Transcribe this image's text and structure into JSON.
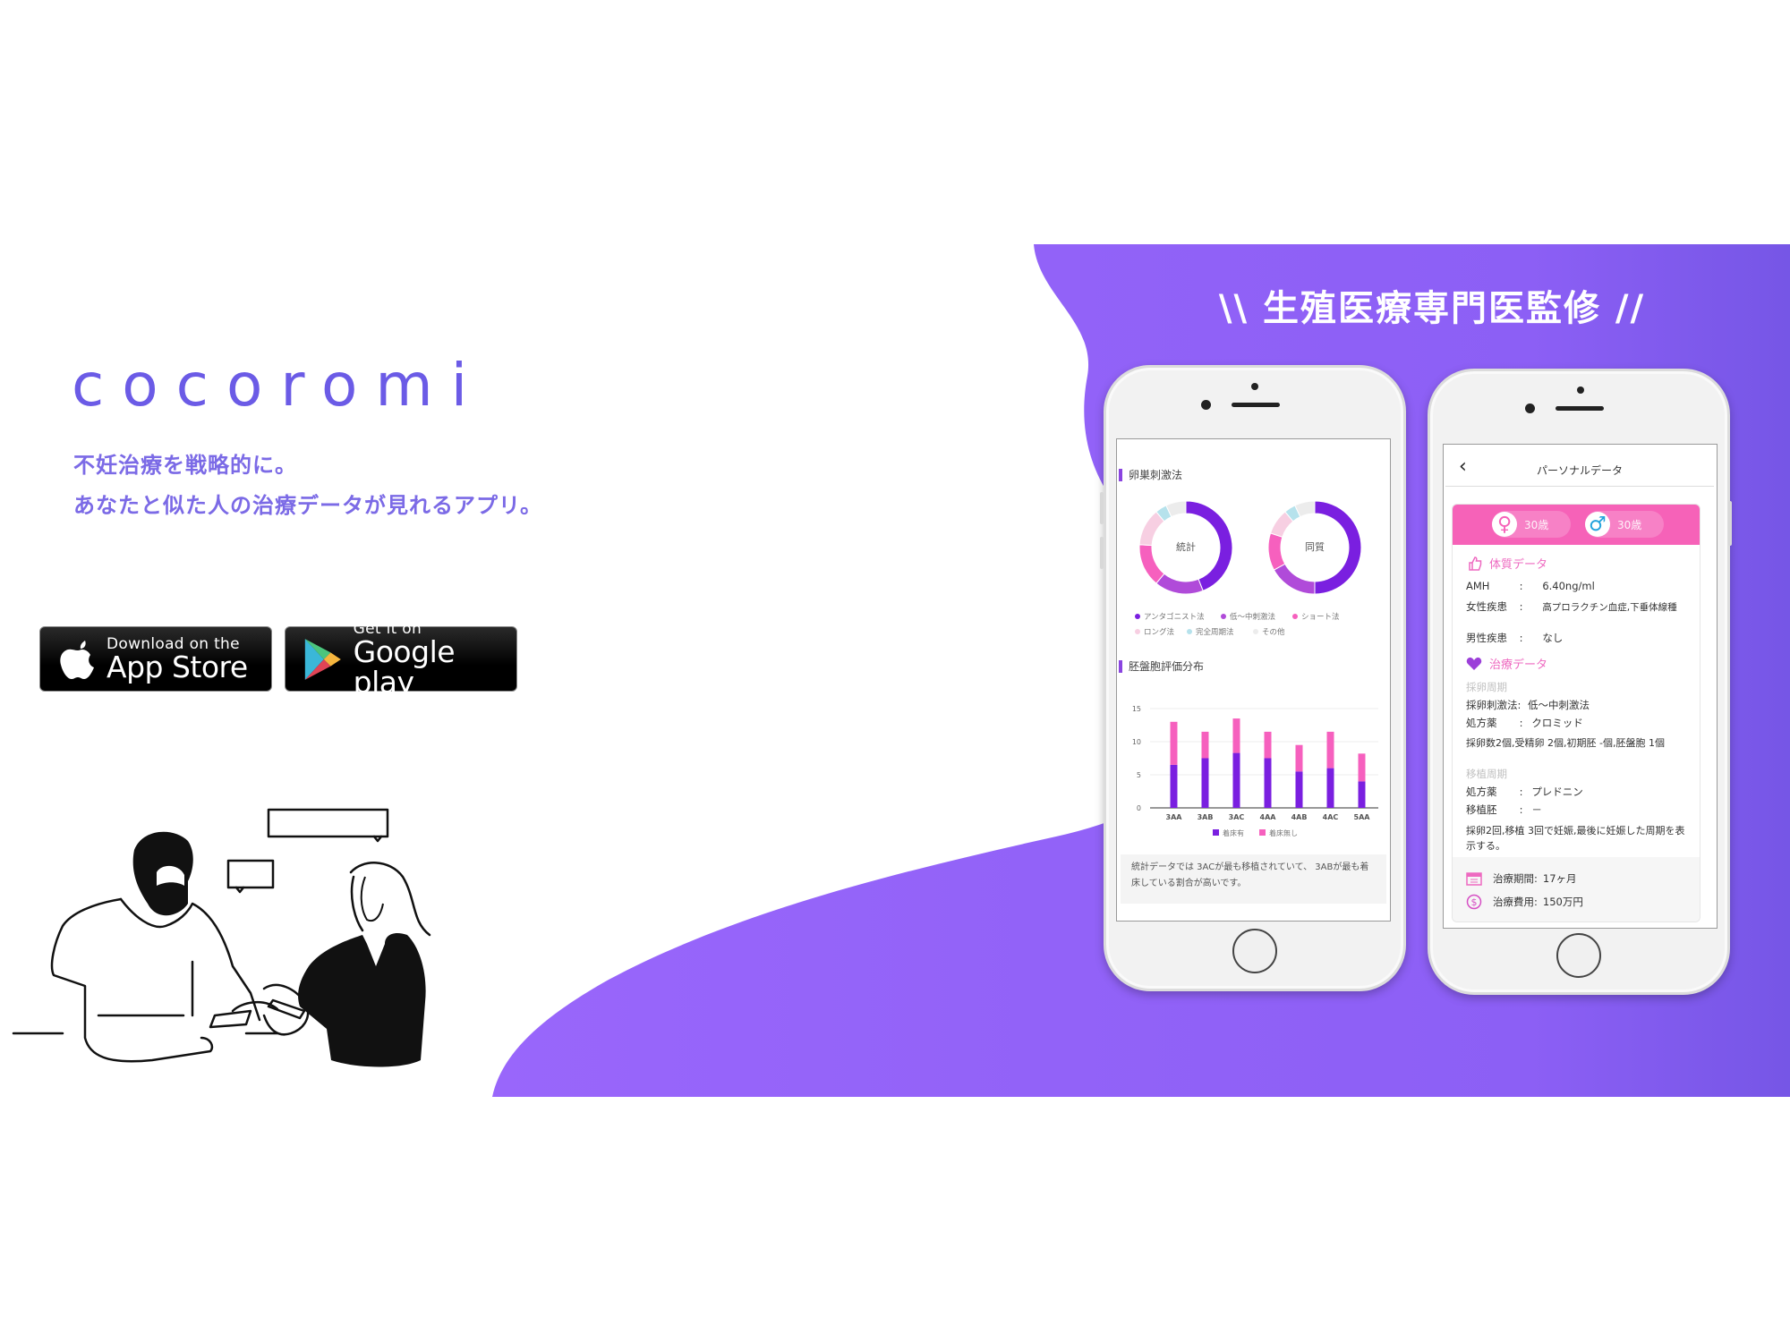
{
  "brand": {
    "logo": "cocoromi",
    "tagline_1": "不妊治療を戦略的に。",
    "tagline_2": "あなたと似た人の治療データが見れるアプリ。",
    "color": "#6b5be6"
  },
  "store_buttons": {
    "app_store": {
      "small": "Download on the",
      "big": "App Store",
      "icon": "apple-icon"
    },
    "google_play": {
      "small": "Get it on",
      "big": "Google play",
      "icon": "play-triangle-icon"
    }
  },
  "hero": {
    "heading": "\\\\ 生殖医療専門医監修 //",
    "accent_color": "#9966fb",
    "gradient_end_color": "#7656e6"
  },
  "phone1": {
    "section_1_title": "卵巣刺激法",
    "donut_1_label": "統計",
    "donut_2_label": "同質",
    "section_2_title": "胚盤胞評価分布",
    "note": "統計データでは 3ACが最も移植されていて、 3ABが最も着床している割合が高いです。"
  },
  "phone2": {
    "nav_title": "パーソナルデータ",
    "back_icon": "chevron-left-icon",
    "female_age": "30歳",
    "male_age": "30歳",
    "physique_title": "体質データ",
    "amh_label": "AMH",
    "amh_value": "6.40ng/ml",
    "female_disease_label": "女性疾患",
    "female_disease_value": "高プロラクチン血症,下垂体線種",
    "male_disease_label": "男性疾患",
    "male_disease_value": "なし",
    "treatment_title": "治療データ",
    "retrieval_cycle": "採卵周期",
    "stim_label": "採卵刺激法:",
    "stim_value": "低～中刺激法",
    "rx_label": "処方薬",
    "rx_value_1": "クロミッド",
    "retrieval_summary": "採卵数2個,受精卵 2個,初期胚 -個,胚盤胞 1個",
    "transfer_cycle": "移植周期",
    "rx_value_2": "プレドニン",
    "transfer_embryo_label": "移植胚",
    "transfer_embryo_value": "－",
    "outcome": "採卵2回,移植 3回で妊娠,最後に妊娠した周期を表示する。",
    "duration_label": "治療期間:",
    "duration_value": "17ヶ月",
    "cost_label": "治療費用:",
    "cost_value": "150万円",
    "colon": ":"
  },
  "chart_data": [
    {
      "type": "pie",
      "title": "卵巣刺激法 - 統計",
      "center_label": "統計",
      "categories": [
        "アンタゴニスト法",
        "低～中刺激法",
        "ショート法",
        "ロング法",
        "完全周期法",
        "その他"
      ],
      "values": [
        44,
        17,
        15,
        13,
        4,
        7
      ],
      "colors": [
        "#7a1fe0",
        "#b04bd9",
        "#f660be",
        "#f7cfe2",
        "#b6e2ec",
        "#ececec"
      ],
      "legend": "bottom"
    },
    {
      "type": "pie",
      "title": "卵巣刺激法 - 同質",
      "center_label": "同質",
      "categories": [
        "アンタゴニスト法",
        "低～中刺激法",
        "ショート法",
        "ロング法",
        "完全周期法",
        "その他"
      ],
      "values": [
        50,
        17,
        13,
        9,
        4,
        7
      ],
      "colors": [
        "#7a1fe0",
        "#b04bd9",
        "#f660be",
        "#f7cfe2",
        "#b6e2ec",
        "#ececec"
      ],
      "legend": "bottom"
    },
    {
      "type": "bar",
      "stacked": true,
      "title": "胚盤胞評価分布",
      "categories": [
        "3AA",
        "3AB",
        "3AC",
        "4AA",
        "4AB",
        "4AC",
        "5AA"
      ],
      "series": [
        {
          "name": "着床有",
          "values": [
            6.5,
            7.5,
            8.3,
            7.5,
            5.5,
            6,
            4
          ],
          "color": "#7a1fe0"
        },
        {
          "name": "着床無し",
          "values": [
            6.5,
            4,
            5.2,
            4,
            4,
            5.5,
            4.2
          ],
          "color": "#f660be"
        }
      ],
      "yticks": [
        0,
        5,
        10,
        15
      ],
      "ylim": [
        0,
        15
      ],
      "grid": true,
      "legend": "bottom"
    }
  ]
}
